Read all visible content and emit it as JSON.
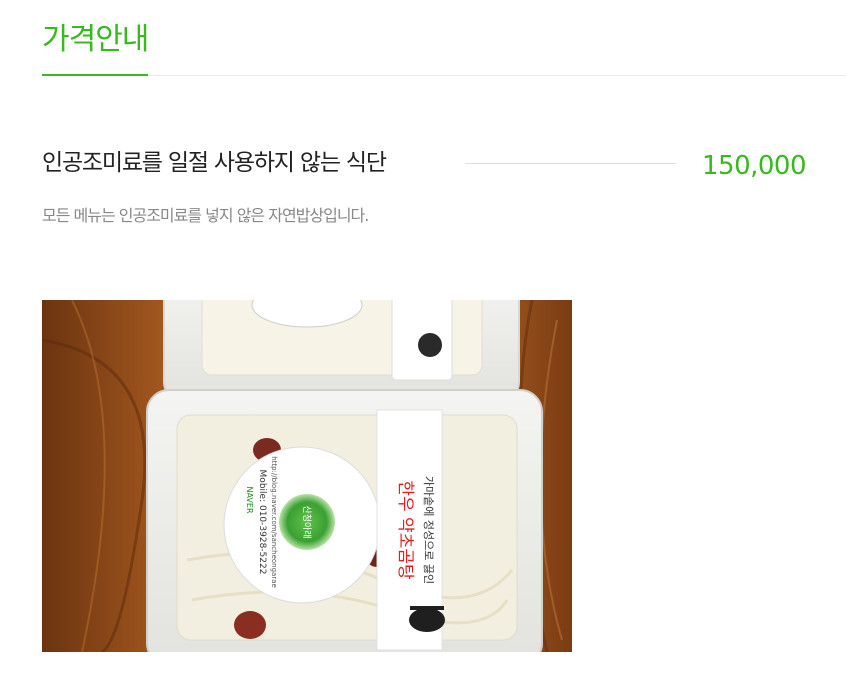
{
  "section": {
    "title": "가격안내"
  },
  "menu_item": {
    "name": "인공조미료를 일절 사용하지 않는 식단",
    "price": "150,000",
    "description": "모든 메뉴는 인공조미료를 넣지 않은 자연밥상입니다."
  },
  "photo": {
    "label_line1": "가마솥에 정성으로 끓인",
    "label_line2": "한우 약초곰탕",
    "sticker_brand": "산청아래",
    "sticker_url": "http://blog.naver.com/sancheongarae",
    "sticker_mobile": "Mobile: 010-3928-5222",
    "sticker_naver": "NAVER"
  },
  "colors": {
    "accent": "#3ab81f",
    "text": "#222222",
    "muted": "#888888",
    "rule": "#ebebeb"
  }
}
